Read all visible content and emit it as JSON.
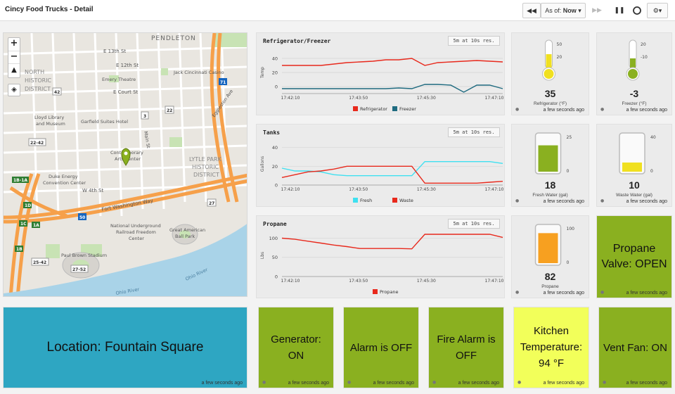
{
  "header": {
    "title": "Cincy Food Trucks - Detail",
    "rewind_icon": "rewind-icon",
    "as_of_label": "As of:",
    "as_of_value": "Now",
    "forward_icon": "forward-icon",
    "pause_icon": "pause-icon",
    "refresh_icon": "refresh-ring-icon",
    "settings_icon": "gear-icon"
  },
  "map": {
    "zoom_in": "+",
    "zoom_out": "−",
    "labels": {
      "pendleton": "PENDLETON",
      "e13th": "E 13th St",
      "e12th": "E 12th St",
      "emery": "Emery Theatre",
      "jack": "Jack Cincinnati Casino",
      "ecourt": "E Court St",
      "historic": "HISTORIC",
      "district": "DISTRICT",
      "nth": "NORTH",
      "lloyd1": "Lloyd Library",
      "lloyd2": "and Museum",
      "garfield": "Garfield Suites Hotel",
      "main": "Main St",
      "eggleston": "Eggleston Ave",
      "contemp1": "Contemporary",
      "contemp2": "Arts Center",
      "lytle1": "LYTLE PARK",
      "lytle2": "HISTORIC",
      "lytle3": "DISTRICT",
      "duke1": "Duke Energy",
      "duke2": "Convention Center",
      "w4th": "W 4th St",
      "fortwash": "Fort Washington Way",
      "nurr1": "National Underground",
      "nurr2": "Railroad Freedom",
      "nurr3": "Center",
      "gabp1": "Great American",
      "gabp2": "Ball Park",
      "paulbrown": "Paul Brown Stadium",
      "ohio1": "Ohio River",
      "ohio2": "Ohio River",
      "r22_42": "22-42",
      "r25_42": "25-42",
      "r27_52": "27-52",
      "r1d": "1D",
      "r1c": "1C",
      "r1a": "1A",
      "r1b": "1B",
      "r1b1a": "1B-1A",
      "r22": "22",
      "r27": "27",
      "r42": "42",
      "r3": "3",
      "r71": "71",
      "r50": "50",
      "r52": "52"
    }
  },
  "charts": {
    "fridge": {
      "title": "Refrigerator/Freezer",
      "resolution": "5m at 10s res.",
      "ylabel": "Temp",
      "yticks": [
        "40",
        "20",
        "0"
      ],
      "xticks": [
        "17:42:10",
        "17:43:50",
        "17:45:30",
        "17:47:10"
      ],
      "legend": [
        "Refrigerator",
        "Freezer"
      ],
      "colors": {
        "refrigerator": "#e8291c",
        "freezer": "#1f6b80"
      }
    },
    "tanks": {
      "title": "Tanks",
      "resolution": "5m at 10s res.",
      "ylabel": "Gallons",
      "yticks": [
        "40",
        "20",
        "0"
      ],
      "xticks": [
        "17:42:10",
        "17:43:50",
        "17:45:30",
        "17:47:10"
      ],
      "legend": [
        "Fresh",
        "Waste"
      ],
      "colors": {
        "fresh": "#3fe0f0",
        "waste": "#e8291c"
      }
    },
    "propane": {
      "title": "Propane",
      "resolution": "5m at 10s res.",
      "ylabel": "Lbs",
      "yticks": [
        "100",
        "50",
        "0"
      ],
      "xticks": [
        "17:42:10",
        "17:43:50",
        "17:45:30",
        "17:47:10"
      ],
      "legend": [
        "Propane"
      ],
      "colors": {
        "propane": "#e8291c"
      }
    }
  },
  "chart_data": [
    {
      "type": "line",
      "title": "Refrigerator/Freezer",
      "ylabel": "Temp",
      "ylim": [
        -10,
        50
      ],
      "x": [
        "17:42:10",
        "17:42:30",
        "17:42:50",
        "17:43:10",
        "17:43:30",
        "17:43:50",
        "17:44:10",
        "17:44:30",
        "17:44:50",
        "17:45:10",
        "17:45:20",
        "17:45:30",
        "17:45:50",
        "17:46:10",
        "17:46:30",
        "17:46:50",
        "17:47:10",
        "17:47:30"
      ],
      "series": [
        {
          "name": "Refrigerator",
          "values": [
            30,
            30,
            30,
            30,
            32,
            34,
            35,
            36,
            38,
            38,
            40,
            30,
            34,
            35,
            36,
            37,
            36,
            35
          ]
        },
        {
          "name": "Freezer",
          "values": [
            -3,
            -3,
            -3,
            -3,
            -3,
            -3,
            -3,
            -3,
            -3,
            -2,
            -3,
            3,
            3,
            2,
            -8,
            2,
            2,
            -3
          ]
        }
      ],
      "legend": "bottom"
    },
    {
      "type": "line",
      "title": "Tanks",
      "ylabel": "Gallons",
      "ylim": [
        0,
        45
      ],
      "x": [
        "17:42:10",
        "17:42:30",
        "17:42:50",
        "17:43:10",
        "17:43:30",
        "17:43:50",
        "17:44:10",
        "17:44:30",
        "17:44:50",
        "17:45:10",
        "17:45:20",
        "17:45:30",
        "17:45:50",
        "17:46:10",
        "17:46:30",
        "17:46:50",
        "17:47:10",
        "17:47:30"
      ],
      "series": [
        {
          "name": "Fresh",
          "values": [
            18,
            15,
            15,
            14,
            11,
            10,
            10,
            10,
            10,
            10,
            10,
            25,
            25,
            25,
            25,
            25,
            25,
            23
          ]
        },
        {
          "name": "Waste",
          "values": [
            8,
            11,
            14,
            15,
            17,
            20,
            20,
            20,
            20,
            20,
            20,
            2,
            2,
            2,
            2,
            2,
            3,
            4
          ]
        }
      ],
      "legend": "bottom"
    },
    {
      "type": "line",
      "title": "Propane",
      "ylabel": "Lbs",
      "ylim": [
        0,
        110
      ],
      "x": [
        "17:42:10",
        "17:42:30",
        "17:42:50",
        "17:43:10",
        "17:43:30",
        "17:43:50",
        "17:44:10",
        "17:44:30",
        "17:44:50",
        "17:45:10",
        "17:45:20",
        "17:45:30",
        "17:45:50",
        "17:46:10",
        "17:46:30",
        "17:46:50",
        "17:47:10",
        "17:47:30"
      ],
      "series": [
        {
          "name": "Propane",
          "values": [
            100,
            97,
            92,
            87,
            82,
            78,
            73,
            73,
            73,
            73,
            72,
            110,
            110,
            110,
            110,
            110,
            110,
            102
          ]
        }
      ],
      "legend": "bottom"
    }
  ],
  "gauges": [
    {
      "key": "refrigerator",
      "value": "35",
      "label": "Refrigerator (°F)",
      "max_label": "50",
      "mid_label": "20",
      "fill": 0.5,
      "color": "#f0e020",
      "kind": "thermo",
      "updated": "a few seconds ago"
    },
    {
      "key": "freezer",
      "value": "-3",
      "label": "Freezer (°F)",
      "max_label": "20",
      "mid_label": "-10",
      "fill": 0.35,
      "color": "#8ab020",
      "kind": "thermo",
      "updated": "a few seconds ago"
    },
    {
      "key": "fresh",
      "value": "18",
      "label": "Fresh Water (gal)",
      "max_label": "25",
      "mid_label": "0",
      "fill": 0.72,
      "color": "#8ab020",
      "kind": "tank",
      "updated": "a few seconds ago"
    },
    {
      "key": "waste",
      "value": "10",
      "label": "Waste Water (gal)",
      "max_label": "40",
      "mid_label": "0",
      "fill": 0.25,
      "color": "#f0e020",
      "kind": "tank",
      "updated": "a few seconds ago"
    },
    {
      "key": "propane",
      "value": "82",
      "label": "Propane",
      "max_label": "100",
      "mid_label": "0",
      "fill": 0.82,
      "color": "#f7a020",
      "kind": "tank",
      "updated": "a few seconds ago"
    }
  ],
  "status": {
    "propane_valve": {
      "text": "Propane Valve: OPEN",
      "color": "#8ab020",
      "updated": "a few seconds ago"
    },
    "location": {
      "text": "Location: Fountain Square",
      "color": "#2ea6c2",
      "updated": "a few seconds ago"
    },
    "generator": {
      "text": "Generator: ON",
      "color": "#8ab020",
      "updated": "a few seconds ago"
    },
    "alarm": {
      "text": "Alarm is OFF",
      "color": "#8ab020",
      "updated": "a few seconds ago"
    },
    "fire_alarm": {
      "text": "Fire Alarm is OFF",
      "color": "#8ab020",
      "updated": "a few seconds ago"
    },
    "kitchen": {
      "text": "Kitchen Temperature: 94 °F",
      "color": "#f2ff5a",
      "updated": "a few seconds ago"
    },
    "vent_fan": {
      "text": "Vent Fan: ON",
      "color": "#8ab020",
      "updated": "a few seconds ago"
    }
  }
}
